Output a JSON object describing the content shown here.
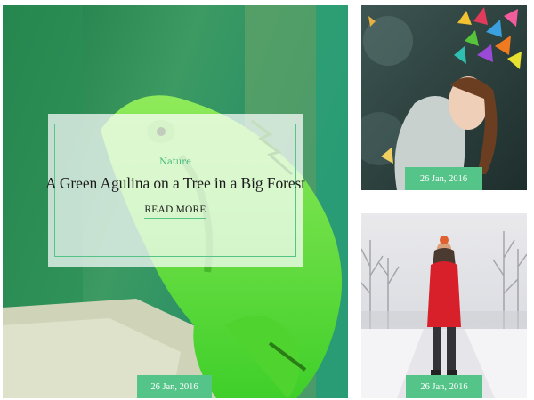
{
  "featured_post": {
    "category": "Nature",
    "title": "A Green Agulina on a Tree in a Big Forest",
    "read_more_label": "READ MORE",
    "date": "26 Jan, 2016"
  },
  "side_posts": [
    {
      "date": "26 Jan, 2016"
    },
    {
      "date": "26 Jan, 2016"
    }
  ],
  "colors": {
    "accent": "#55c489",
    "overlay": "#ffffff"
  }
}
